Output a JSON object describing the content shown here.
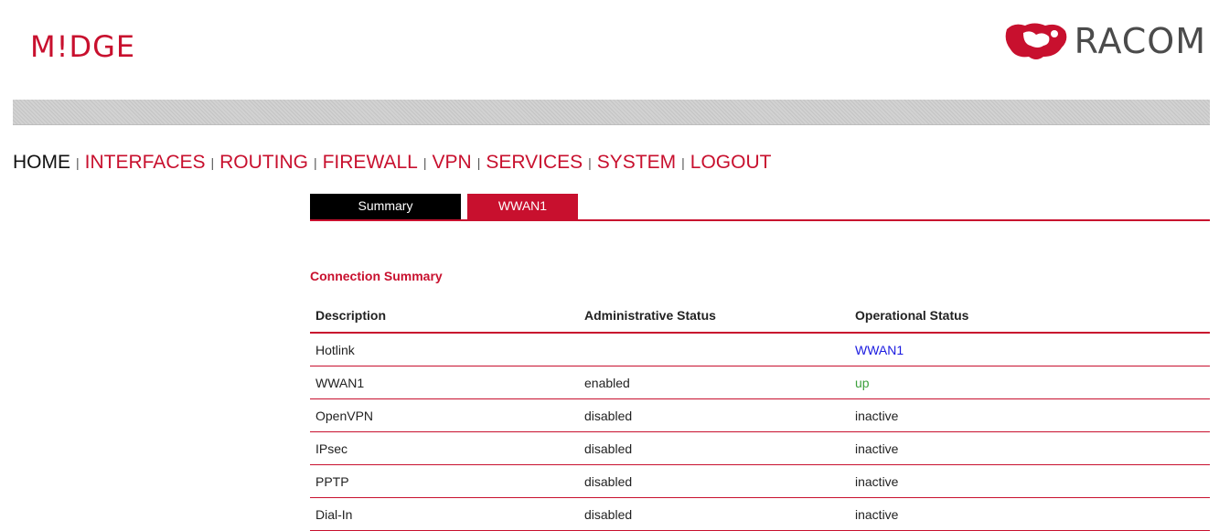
{
  "logo_left_text": "M!DGE",
  "logo_right_text": "RACOM",
  "nav": {
    "items": [
      "HOME",
      "INTERFACES",
      "ROUTING",
      "FIREWALL",
      "VPN",
      "SERVICES",
      "SYSTEM",
      "LOGOUT"
    ],
    "separator": "|"
  },
  "tabs": [
    "Summary",
    "WWAN1"
  ],
  "section_title": "Connection Summary",
  "table": {
    "headers": [
      "Description",
      "Administrative Status",
      "Operational Status"
    ],
    "rows": [
      [
        "Hotlink",
        "",
        "WWAN1"
      ],
      [
        "WWAN1",
        "enabled",
        "up"
      ],
      [
        "OpenVPN",
        "disabled",
        "inactive"
      ],
      [
        "IPsec",
        "disabled",
        "inactive"
      ],
      [
        "PPTP",
        "disabled",
        "inactive"
      ],
      [
        "Dial-In",
        "disabled",
        "inactive"
      ]
    ]
  },
  "colors": {
    "brand_red": "#c8102e",
    "link_blue": "#1a1ae0",
    "status_up_green": "#3ca03c"
  }
}
